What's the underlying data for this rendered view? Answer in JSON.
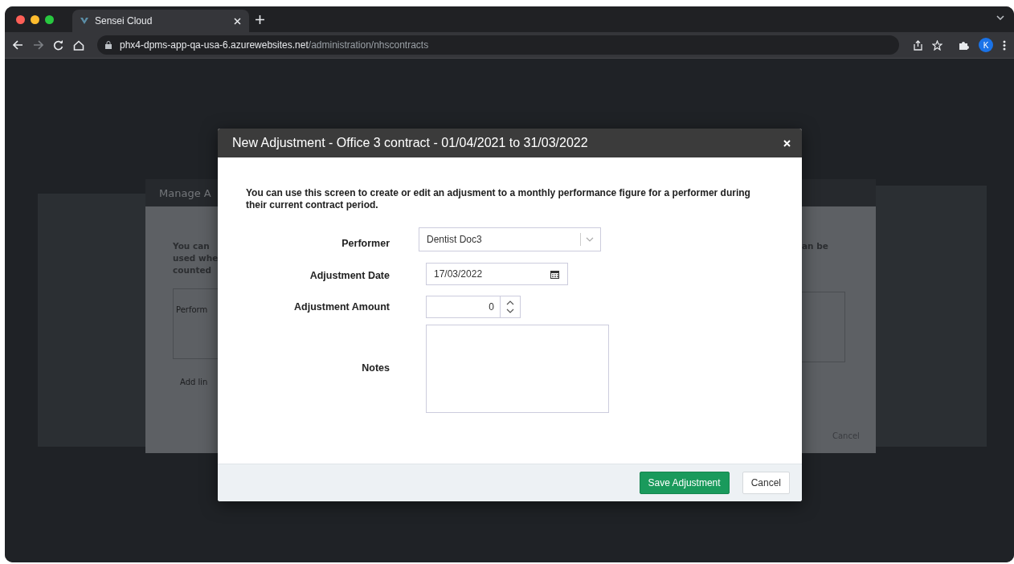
{
  "browser": {
    "tab": {
      "title": "Sensei Cloud",
      "selected": true
    },
    "url_host": "phx4-dpms-app-qa-usa-6.azurewebsites.net",
    "url_path": "/administration/nhscontracts",
    "profile_initial": "K"
  },
  "background_dialog": {
    "title": "Manage A",
    "intro_lines": [
      "You can",
      "used whe",
      "counted"
    ],
    "intro_right": "an be",
    "table_header": "Perform",
    "add_link": "Add lin",
    "cancel": "Cancel"
  },
  "modal": {
    "title": "New Adjustment - Office 3 contract - 01/04/2021 to 31/03/2022",
    "description": "You can use this screen to create or edit an adjusment to a monthly performance figure for a performer during their current contract period.",
    "fields": [
      {
        "kind": "select",
        "label": "Performer",
        "value": "Dentist Doc3"
      },
      {
        "kind": "date",
        "label": "Adjustment Date",
        "value": "17/03/2022"
      },
      {
        "kind": "number",
        "label": "Adjustment Amount",
        "value": "0"
      },
      {
        "kind": "textarea",
        "label": "Notes"
      }
    ],
    "buttons": [
      {
        "kind": "primary",
        "label": "Save Adjustment"
      },
      {
        "kind": "default",
        "label": "Cancel"
      }
    ]
  }
}
